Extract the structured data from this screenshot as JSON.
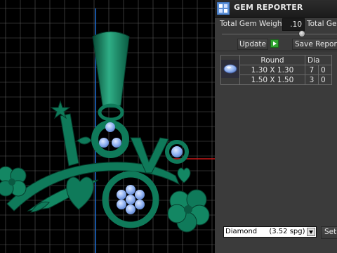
{
  "viewport": {
    "background": "#000000",
    "grid_color": "#5a5a5a",
    "axis_color": "#1e6fd6",
    "axis_h_color": "#c61818",
    "model_color": "#0f7a5a",
    "gem_color": "#8ab0f0",
    "icon_names": [
      "star-icon",
      "heart-icon",
      "flower-icon"
    ]
  },
  "panel": {
    "title": "GEM REPORTER",
    "total_gem_weight_label": "Total Gem Weight",
    "total_gem_weight_value": ".10",
    "total_gem_label_2": "Total Gem",
    "update_label": "Update",
    "save_report_label": "Save Report",
    "table": {
      "headers": [
        "Round",
        "Dia"
      ],
      "rows": [
        {
          "size": "1.30 X 1.30",
          "count": "7",
          "dia": "0"
        },
        {
          "size": "1.50 X 1.50",
          "count": "3",
          "dia": "0"
        }
      ]
    },
    "material_select": "Diamond",
    "material_spg": "(3.52 spg)",
    "set_label": "Set"
  }
}
